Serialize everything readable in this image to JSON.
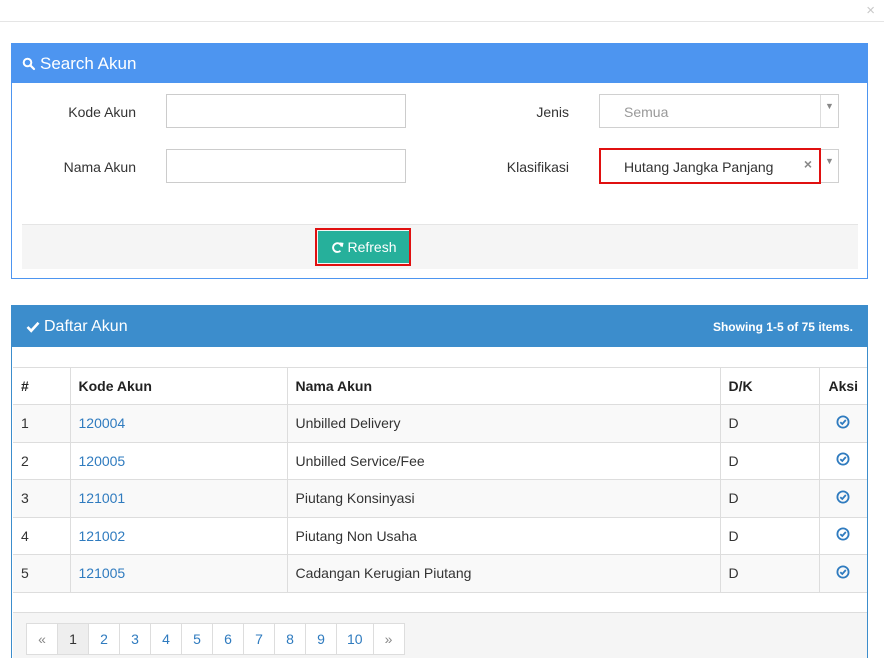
{
  "modal": {
    "close_label": "×"
  },
  "search": {
    "title": "Search Akun",
    "kode_akun_label": "Kode Akun",
    "kode_akun_value": "",
    "nama_akun_label": "Nama Akun",
    "nama_akun_value": "",
    "jenis_label": "Jenis",
    "jenis_value": "Semua",
    "klasifikasi_label": "Klasifikasi",
    "klasifikasi_value": "Hutang Jangka Panjang",
    "refresh_label": "Refresh"
  },
  "list": {
    "title": "Daftar Akun",
    "summary_prefix": "Showing ",
    "summary_range": "1-5",
    "summary_mid": " of ",
    "summary_total": "75",
    "summary_suffix": " items.",
    "columns": [
      "#",
      "Kode Akun",
      "Nama Akun",
      "D/K",
      "Aksi"
    ],
    "rows": [
      {
        "no": "1",
        "kode": "120004",
        "nama": "Unbilled Delivery",
        "dk": "D"
      },
      {
        "no": "2",
        "kode": "120005",
        "nama": "Unbilled Service/Fee",
        "dk": "D"
      },
      {
        "no": "3",
        "kode": "121001",
        "nama": "Piutang Konsinyasi",
        "dk": "D"
      },
      {
        "no": "4",
        "kode": "121002",
        "nama": "Piutang Non Usaha",
        "dk": "D"
      },
      {
        "no": "5",
        "kode": "121005",
        "nama": "Cadangan Kerugian Piutang",
        "dk": "D"
      }
    ]
  },
  "pagination": {
    "prev": "«",
    "pages": [
      "1",
      "2",
      "3",
      "4",
      "5",
      "6",
      "7",
      "8",
      "9",
      "10"
    ],
    "next": "»",
    "active_page": "1"
  },
  "colors": {
    "search_header": "#4d95f0",
    "list_header": "#3c8dcc",
    "refresh_button": "#26b09b",
    "highlight_outline": "#e01010",
    "link": "#2f7bbf"
  },
  "icons": {
    "search_header": "search-icon",
    "refresh": "refresh-icon",
    "list_header": "check-icon",
    "row_action": "check-circle-icon"
  }
}
